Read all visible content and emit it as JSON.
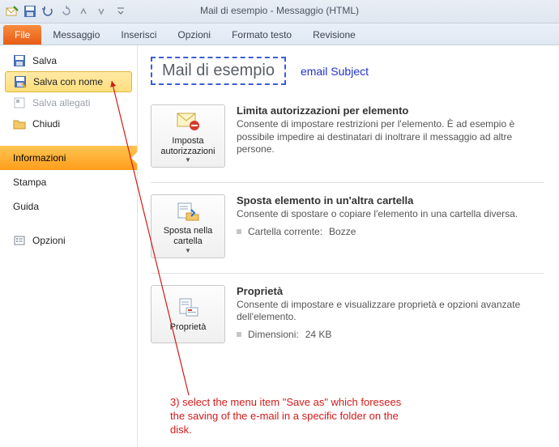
{
  "window": {
    "title": "Mail di esempio  -  Messaggio (HTML)"
  },
  "ribbon": {
    "file": "File",
    "tabs": [
      "Messaggio",
      "Inserisci",
      "Opzioni",
      "Formato testo",
      "Revisione"
    ]
  },
  "sidebar": {
    "salva": "Salva",
    "salva_con_nome": "Salva con nome",
    "salva_allegati": "Salva allegati",
    "chiudi": "Chiudi",
    "informazioni": "Informazioni",
    "stampa": "Stampa",
    "guida": "Guida",
    "opzioni": "Opzioni"
  },
  "content": {
    "subject_value": "Mail di esempio",
    "subject_label": "email Subject",
    "sections": {
      "perm": {
        "button_label": "Imposta autorizzazioni",
        "title": "Limita autorizzazioni per elemento",
        "desc": "Consente di impostare restrizioni per l'elemento. È ad esempio è possibile impedire ai destinatari di inoltrare il messaggio ad altre persone."
      },
      "move": {
        "button_label": "Sposta nella cartella",
        "title": "Sposta elemento in un'altra cartella",
        "desc": "Consente di spostare o copiare l'elemento in una cartella diversa.",
        "kv_label": "Cartella corrente:",
        "kv_value": "Bozze"
      },
      "props": {
        "button_label": "Proprietà",
        "title": "Proprietà",
        "desc": "Consente di impostare e visualizzare proprietà e opzioni avanzate dell'elemento.",
        "kv_label": "Dimensioni:",
        "kv_value": "24 KB"
      }
    }
  },
  "annotation": {
    "text": "3) select the menu item \"Save as\" which foresees the saving of the e-mail in a specific folder on the disk."
  }
}
